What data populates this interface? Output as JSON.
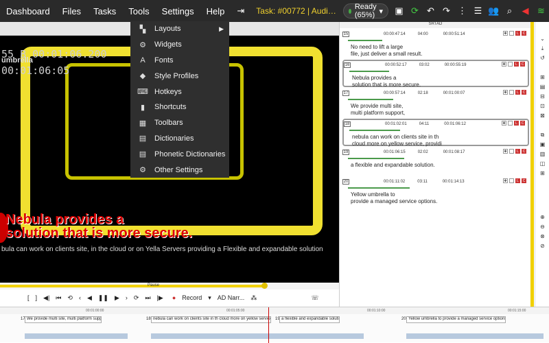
{
  "topbar": {
    "menus": [
      "Dashboard",
      "Files",
      "Tasks",
      "Tools",
      "Settings",
      "Help"
    ],
    "task": "Task: #00772 | Audio Description: ...",
    "status": "Ready (65%)"
  },
  "video": {
    "timecode": "55 B  00:01:06.200",
    "timecode2": "00:01:06:05",
    "logo": "umbrella",
    "caption_line1": "Nebula provides a",
    "caption_line2": "solution that is more secure.",
    "subtitle": "bula can work on clients site, in the cloud or on Yella Servers providing a Flexible and expandable solution"
  },
  "seek": {
    "label": "Pause",
    "progress": 0.78
  },
  "transport": {
    "record": "Record",
    "ad": "AD Narr..."
  },
  "panel": {
    "title": "SRTAD"
  },
  "segments": [
    {
      "num": "15",
      "start": "00:00:47:14",
      "dur": "04:00",
      "end": "00:00:51:14",
      "line1": "No need to lift a large",
      "line2": "file, just deliver a small result."
    },
    {
      "num": "16",
      "start": "00:00:52:17",
      "dur": "03:02",
      "end": "00:00:55:19",
      "line1": "Nebula provides a",
      "line2": "solution that is more secure."
    },
    {
      "num": "17",
      "start": "00:00:57:14",
      "dur": "02:18",
      "end": "00:01:00:07",
      "line1": "We provide multi site,",
      "line2": "multi platform support,"
    },
    {
      "num": "18",
      "start": "00:01:02:01",
      "dur": "04:11",
      "end": "00:01:06:12",
      "line1": "nebula can work on clients site in th",
      "line2": "cloud more on yellow service, providi"
    },
    {
      "num": "19",
      "start": "00:01:06:15",
      "dur": "02:02",
      "end": "00:01:08:17",
      "line1": "a flexible and expandable solution.",
      "line2": ""
    },
    {
      "num": "20",
      "start": "00:01:11:02",
      "dur": "03:11",
      "end": "00:01:14:13",
      "line1": "Yellow umbrella to",
      "line2": "provide a managed service options."
    }
  ],
  "menu": {
    "items": [
      {
        "label": "Layouts",
        "icon": "layouts-icon"
      },
      {
        "label": "Widgets",
        "icon": "gear-icon"
      },
      {
        "label": "Fonts",
        "icon": "font-icon"
      },
      {
        "label": "Style Profiles",
        "icon": "style-icon"
      },
      {
        "label": "Hotkeys",
        "icon": "keyboard-icon"
      },
      {
        "label": "Shortcuts",
        "icon": "bookmark-icon"
      },
      {
        "label": "Toolbars",
        "icon": "grid-icon"
      },
      {
        "label": "Dictionaries",
        "icon": "book-icon"
      },
      {
        "label": "Phonetic Dictionaries",
        "icon": "book-icon"
      },
      {
        "label": "Other Settings",
        "icon": "gear-icon"
      }
    ]
  },
  "timeline": {
    "ruler": [
      "00:01:00:00",
      "00:01:05:00",
      "00:01:10:00",
      "00:01:15:00"
    ],
    "blocks": [
      {
        "num": "17",
        "text": "We provide multi site, multi platform support,"
      },
      {
        "num": "18",
        "text": "nebula can work on clients site in th cloud more on yellow service, providi"
      },
      {
        "num": "19",
        "text": "a flexible and expandable solution."
      },
      {
        "num": "20",
        "text": "Yellow umbrella to provide a managed service options."
      }
    ]
  }
}
